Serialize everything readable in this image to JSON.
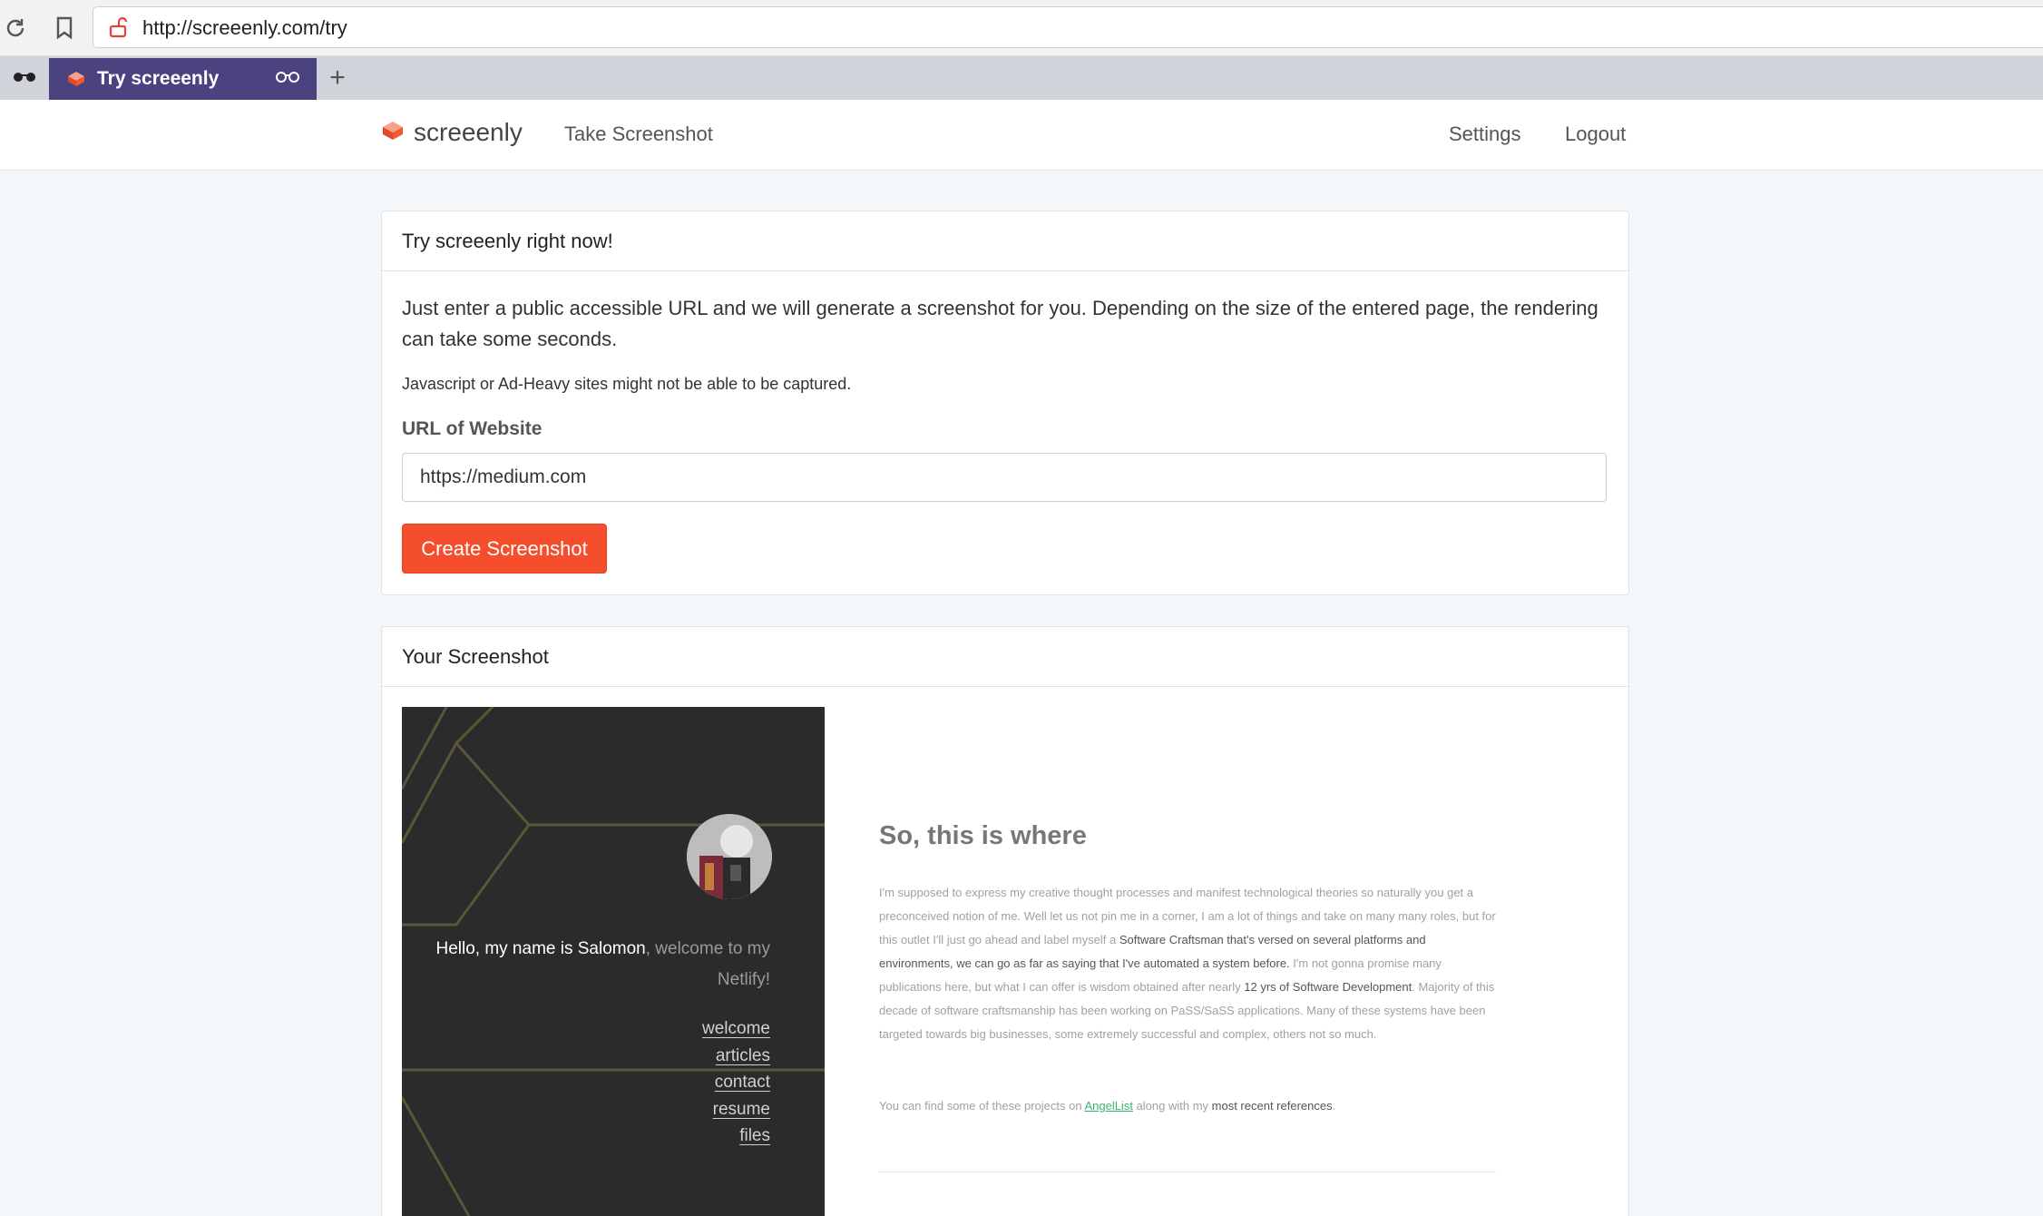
{
  "browser": {
    "url": "http://screeenly.com/try",
    "tab_title": "Try screeenly",
    "new_tab_label": "+"
  },
  "nav": {
    "brand": "screeenly",
    "take_screenshot": "Take Screenshot",
    "settings": "Settings",
    "logout": "Logout"
  },
  "try_card": {
    "header": "Try screeenly right now!",
    "intro": "Just enter a public accessible URL and we will generate a screenshot for you. Depending on the size of the entered page, the rendering can take some seconds.",
    "note": "Javascript or Ad-Heavy sites might not be able to be captured.",
    "url_label": "URL of Website",
    "url_value": "https://medium.com",
    "create_button": "Create Screenshot"
  },
  "result_card": {
    "header": "Your Screenshot"
  },
  "preview": {
    "hello_name": "Hello, my name is Salomon",
    "hello_rest": ", welcome to my Netlify!",
    "links": [
      "welcome",
      "articles",
      "contact",
      "resume",
      "files"
    ],
    "title": "So, this is where",
    "body_1": "I'm supposed to express my creative thought processes and manifest technological theories so naturally you get a preconceived notion of me. Well let us not pin me in a corner, I am a lot of things and take on many many roles, but for this outlet I'll just go ahead and label myself a ",
    "body_strong_1": "Software Craftsman that's versed on several platforms and environments, we can go as far as saying that I've automated a system before.",
    "body_2": " I'm not gonna promise many publications here, but what I can offer is wisdom obtained after nearly ",
    "body_strong_2": "12 yrs of Software Development",
    "body_3": ". Majority of this decade of software craftsmanship has been working on PaSS/SaSS applications. Many of these systems have been targeted towards big businesses, some extremely successful and complex, others not so much.",
    "foot_1": "You can find some of these projects on ",
    "foot_link": "AngelList",
    "foot_2": " along with my ",
    "foot_strong": "most recent references",
    "foot_3": "."
  },
  "colors": {
    "accent": "#f54e2c",
    "tab_active": "#4a4380",
    "preview_dark": "#2b2b2b",
    "link_green": "#3cb371"
  },
  "icons": [
    "reload-icon",
    "bookmark-icon",
    "lock-icon",
    "glasses-icon",
    "screeenly-logo-icon"
  ]
}
